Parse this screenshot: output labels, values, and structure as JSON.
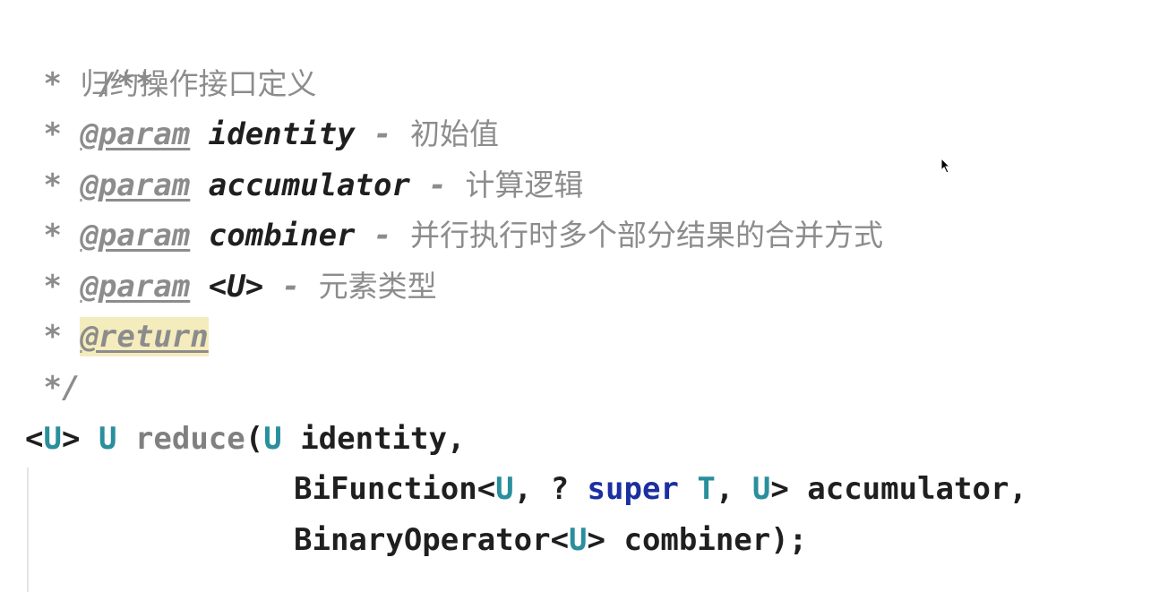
{
  "comment": {
    "open": "/**",
    "star": "*",
    "summary": "归约操作接口定义",
    "params": [
      {
        "tag": "@param",
        "name": "identity",
        "dash": "-",
        "desc": "初始值"
      },
      {
        "tag": "@param",
        "name": "accumulator",
        "dash": "-",
        "desc": "计算逻辑"
      },
      {
        "tag": "@param",
        "name": "combiner",
        "dash": "-",
        "desc": "并行执行时多个部分结果的合并方式"
      },
      {
        "tag": "@param",
        "name": "<U>",
        "dash": "-",
        "desc": "元素类型"
      }
    ],
    "return_tag": "@return",
    "close": "*/"
  },
  "signature": {
    "line1": {
      "lt": "<",
      "tp": "U",
      "gt": ">",
      "ret": "U",
      "method": "reduce",
      "paren": "(",
      "ptype": "U",
      "pname": "identity,"
    },
    "line2": {
      "type": "BiFunction<",
      "tp1": "U",
      "comma1": ", ? ",
      "kw": "super",
      "tp2": "T",
      "comma2": ", ",
      "tp3": "U",
      "end": "> accumulator,"
    },
    "line3": {
      "type": "BinaryOperator<",
      "tp": "U",
      "end": "> combiner);"
    }
  }
}
